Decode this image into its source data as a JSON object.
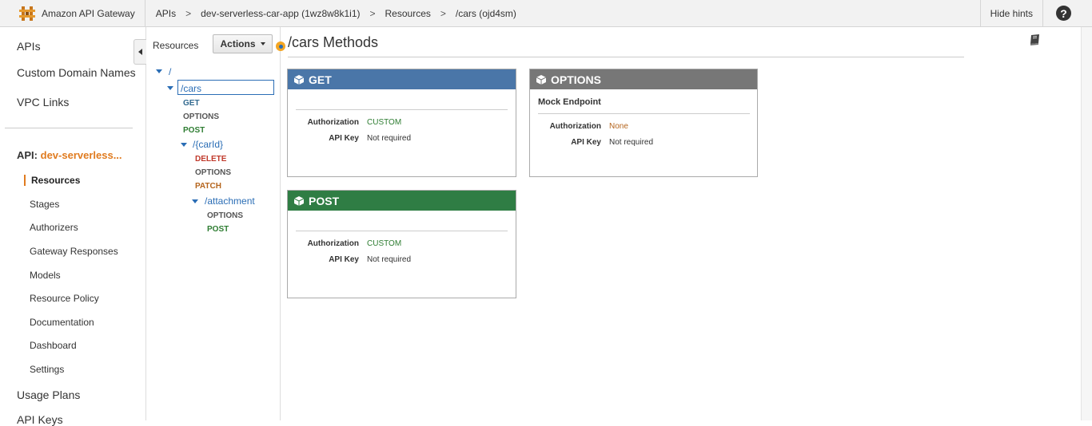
{
  "topbar": {
    "brand": "Amazon API Gateway",
    "breadcrumbs": [
      "APIs",
      "dev-serverless-car-app (1wz8w8k1i1)",
      "Resources",
      "/cars (ojd4sm)"
    ],
    "separator": ">",
    "hide_hints": "Hide hints",
    "help": "?"
  },
  "sidebar": {
    "top_items": [
      "APIs",
      "Custom Domain Names",
      "VPC Links"
    ],
    "api_prefix": "API:",
    "api_name": "dev-serverless...",
    "sub_items": [
      "Resources",
      "Stages",
      "Authorizers",
      "Gateway Responses",
      "Models",
      "Resource Policy",
      "Documentation",
      "Dashboard",
      "Settings"
    ],
    "active_sub": "Resources",
    "bottom_items": [
      "Usage Plans",
      "API Keys"
    ]
  },
  "resources_panel": {
    "title": "Resources",
    "actions_label": "Actions",
    "tree": {
      "root": "/",
      "cars": "/cars",
      "cars_methods": [
        "GET",
        "OPTIONS",
        "POST"
      ],
      "carid": "/{carId}",
      "carid_methods": [
        "DELETE",
        "OPTIONS",
        "PATCH"
      ],
      "attachment": "/attachment",
      "attachment_methods": [
        "OPTIONS",
        "POST"
      ]
    }
  },
  "main": {
    "title": "/cars Methods",
    "cards": {
      "get": {
        "method": "GET",
        "color": "#4a76a8",
        "auth_label": "Authorization",
        "auth_value": "CUSTOM",
        "key_label": "API Key",
        "key_value": "Not required"
      },
      "options": {
        "method": "OPTIONS",
        "color": "#777777",
        "subtitle": "Mock Endpoint",
        "auth_label": "Authorization",
        "auth_value": "None",
        "key_label": "API Key",
        "key_value": "Not required"
      },
      "post": {
        "method": "POST",
        "color": "#2f7d44",
        "auth_label": "Authorization",
        "auth_value": "CUSTOM",
        "key_label": "API Key",
        "key_value": "Not required"
      }
    }
  },
  "colors": {
    "accent": "#e07b1f",
    "link": "#2a6db5"
  }
}
